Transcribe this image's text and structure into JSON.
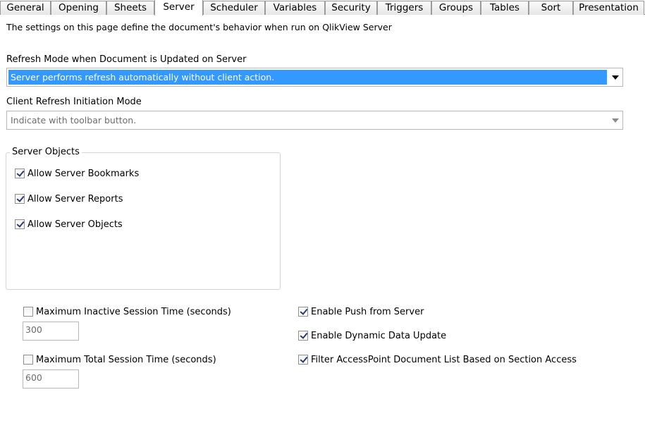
{
  "tabs": [
    {
      "label": "General",
      "active": false
    },
    {
      "label": "Opening",
      "active": false
    },
    {
      "label": "Sheets",
      "active": false
    },
    {
      "label": "Server",
      "active": true
    },
    {
      "label": "Scheduler",
      "active": false
    },
    {
      "label": "Variables",
      "active": false
    },
    {
      "label": "Security",
      "active": false
    },
    {
      "label": "Triggers",
      "active": false
    },
    {
      "label": "Groups",
      "active": false
    },
    {
      "label": "Tables",
      "active": false
    },
    {
      "label": "Sort",
      "active": false
    },
    {
      "label": "Presentation",
      "active": false
    }
  ],
  "intro_text": "The settings on this page define the document's behavior when run on QlikView Server",
  "refresh_mode": {
    "label": "Refresh Mode when Document is Updated on Server",
    "value": "Server performs refresh automatically without client action."
  },
  "client_refresh": {
    "label": "Client Refresh Initiation Mode",
    "value": "Indicate with toolbar button."
  },
  "server_objects": {
    "title": "Server Objects",
    "items": [
      {
        "label": "Allow Server Bookmarks",
        "checked": true
      },
      {
        "label": "Allow Server Reports",
        "checked": true
      },
      {
        "label": "Allow Server Objects",
        "checked": true
      }
    ]
  },
  "max_inactive": {
    "label": "Maximum Inactive Session Time (seconds)",
    "checked": false,
    "value": "300"
  },
  "max_total": {
    "label": "Maximum Total Session Time (seconds)",
    "checked": false,
    "value": "600"
  },
  "right_options": [
    {
      "label": "Enable Push from Server",
      "checked": true
    },
    {
      "label": "Enable Dynamic Data Update",
      "checked": true
    },
    {
      "label": "Filter AccessPoint Document List Based on Section Access",
      "checked": true
    }
  ],
  "colors": {
    "selection": "#3399ff",
    "border": "#b8b8b8"
  }
}
